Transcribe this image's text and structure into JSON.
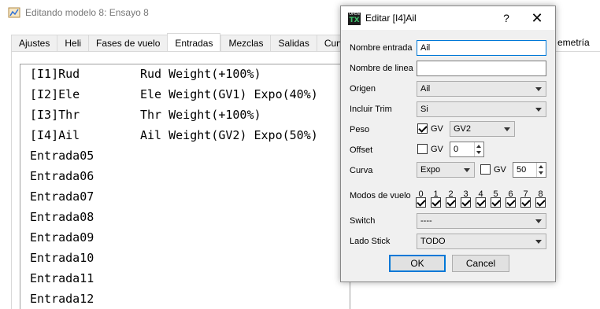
{
  "window": {
    "title": "Editando modelo 8: Ensayo 8"
  },
  "tabs": [
    "Ajustes",
    "Heli",
    "Fases de vuelo",
    "Entradas",
    "Mezclas",
    "Salidas",
    "Curva"
  ],
  "tab_partial_right": "emetría",
  "inputs": [
    {
      "name": "[I1]Rud",
      "line": "Rud Weight(+100%)"
    },
    {
      "name": "[I2]Ele",
      "line": "Ele Weight(GV1) Expo(40%)"
    },
    {
      "name": "[I3]Thr",
      "line": "Thr Weight(+100%)"
    },
    {
      "name": "[I4]Ail",
      "line": "Ail Weight(GV2) Expo(50%)"
    },
    {
      "name": "Entrada05",
      "line": ""
    },
    {
      "name": "Entrada06",
      "line": ""
    },
    {
      "name": "Entrada07",
      "line": ""
    },
    {
      "name": "Entrada08",
      "line": ""
    },
    {
      "name": "Entrada09",
      "line": ""
    },
    {
      "name": "Entrada10",
      "line": ""
    },
    {
      "name": "Entrada11",
      "line": ""
    },
    {
      "name": "Entrada12",
      "line": ""
    }
  ],
  "dialog": {
    "title": "Editar [I4]Ail",
    "help": "?",
    "close": "✕",
    "icon_text_top": "OPEN",
    "icon_text_main": "TX",
    "labels": {
      "input_name": "Nombre entrada",
      "line_name": "Nombre de linea",
      "source": "Origen",
      "include_trim": "Incluir Trim",
      "weight": "Peso",
      "offset": "Offset",
      "curve": "Curva",
      "flight_modes": "Modos de vuelo",
      "switch": "Switch",
      "stick_side": "Lado Stick"
    },
    "values": {
      "input_name": "Ail",
      "line_name": "",
      "source": "Ail",
      "include_trim": "Si",
      "weight_gv_label": "GV",
      "weight_value": "GV2",
      "offset_gv_label": "GV",
      "offset_value": "0",
      "curve_type": "Expo",
      "curve_gv_label": "GV",
      "curve_value": "50",
      "switch": "----",
      "stick_side": "TODO"
    },
    "flight_modes": [
      "0",
      "1",
      "2",
      "3",
      "4",
      "5",
      "6",
      "7",
      "8"
    ],
    "ok": "OK",
    "cancel": "Cancel"
  },
  "colors": {
    "focus": "#0078d7",
    "dialog_bg": "#f0f0f0"
  }
}
